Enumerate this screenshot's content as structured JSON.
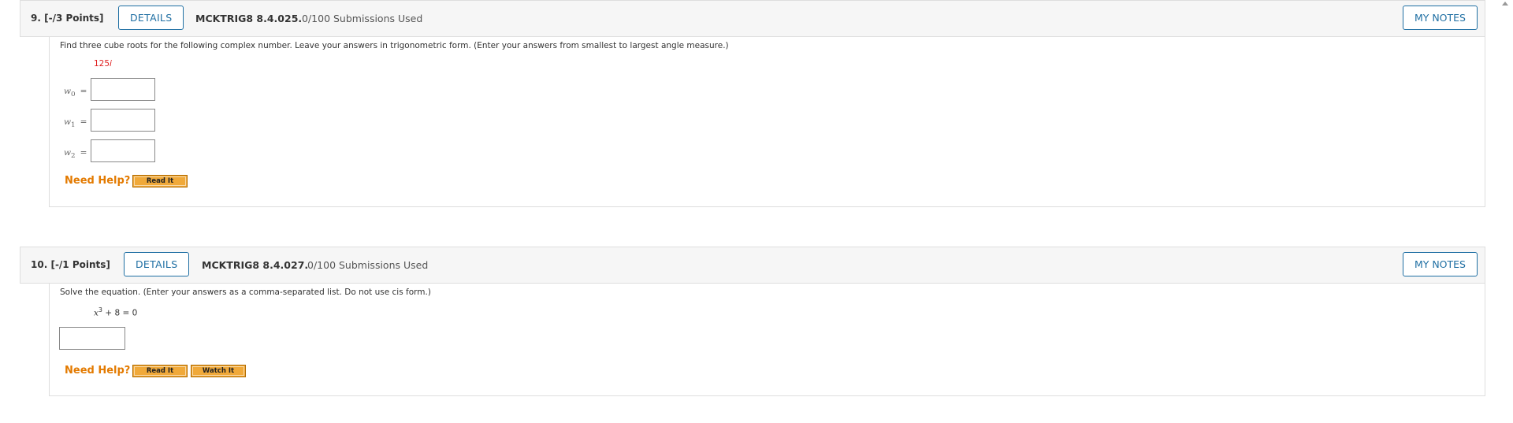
{
  "questions": [
    {
      "number": "9.",
      "points": "[-/3 Points]",
      "details_label": "DETAILS",
      "code": "MCKTRIG8 8.4.025.",
      "submissions": "0/100 Submissions Used",
      "notes_label": "MY NOTES",
      "prompt": "Find three cube roots for the following complex number. Leave your answers in trigonometric form. (Enter your answers from smallest to largest angle measure.)",
      "expression": "125",
      "expression_i": "i",
      "answers": [
        {
          "label": "w",
          "sub": "0",
          "eq": "=",
          "value": ""
        },
        {
          "label": "w",
          "sub": "1",
          "eq": "=",
          "value": ""
        },
        {
          "label": "w",
          "sub": "2",
          "eq": "=",
          "value": ""
        }
      ],
      "need_help": "Need Help?",
      "help_buttons": [
        "Read It"
      ]
    },
    {
      "number": "10.",
      "points": "[-/1 Points]",
      "details_label": "DETAILS",
      "code": "MCKTRIG8 8.4.027.",
      "submissions": "0/100 Submissions Used",
      "notes_label": "MY NOTES",
      "prompt": "Solve the equation. (Enter your answers as a comma-separated list. Do not use cis form.)",
      "expression_base": "x",
      "expression_exp": "3",
      "expression_rest": " + 8 = 0",
      "answer_value": "",
      "need_help": "Need Help?",
      "help_buttons": [
        "Read It",
        "Watch It"
      ]
    }
  ]
}
